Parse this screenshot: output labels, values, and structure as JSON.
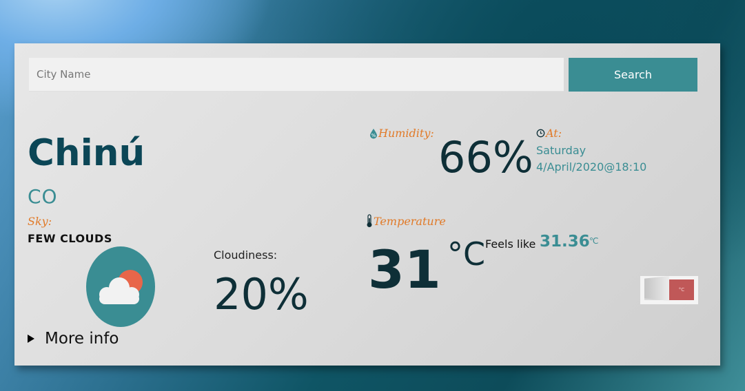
{
  "search": {
    "placeholder": "City Name",
    "value": "",
    "button_label": "Search"
  },
  "location": {
    "city": "Chinú",
    "country": "CO"
  },
  "sky": {
    "label": "Sky:",
    "description": "FEW CLOUDS",
    "icon": "cloud-sun-icon"
  },
  "cloudiness": {
    "label": "Cloudiness:",
    "value": "20%"
  },
  "humidity": {
    "label": "Humidity:",
    "value": "66%",
    "icon": "humidity-drop-icon"
  },
  "time": {
    "label": "At:",
    "day": "Saturday",
    "datetime": "4/April/2020@18:10",
    "icon": "clock-icon"
  },
  "temperature": {
    "label": "Temperature",
    "value": "31",
    "unit": "°C",
    "feels_like_label": "Feels like",
    "feels_like_value": "31.36",
    "feels_like_unit": "℃",
    "icon": "thermometer-icon"
  },
  "unit_toggle": {
    "fahrenheit": "°F",
    "celsius": "°C",
    "selected": "celsius"
  },
  "more_info": {
    "label": "More info"
  },
  "colors": {
    "accent": "#3a8d93",
    "label": "#e17a28",
    "dark_text": "#0e2f37",
    "city": "#0b4656",
    "toggle_active": "#c05858"
  }
}
